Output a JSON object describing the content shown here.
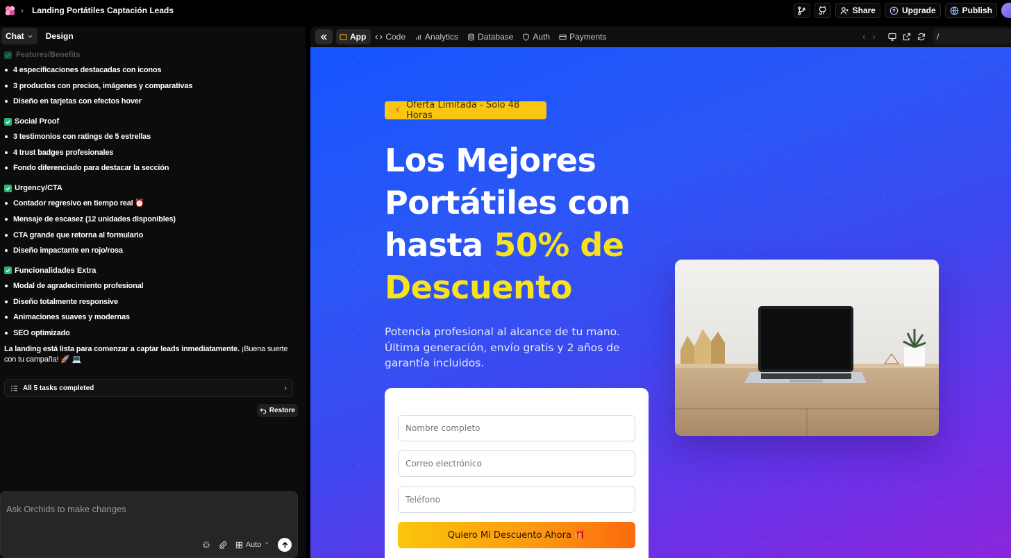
{
  "topbar": {
    "title": "Landing Portátiles Captación Leads",
    "share_label": "Share",
    "upgrade_label": "Upgrade",
    "publish_label": "Publish"
  },
  "left_tabs": {
    "chat": "Chat",
    "design": "Design"
  },
  "chat": {
    "faded_heading": "Features/Benefits",
    "group1": [
      "4 especificaciones destacadas con iconos",
      "3 productos con precios, imágenes y comparativas",
      "Diseño en tarjetas con efectos hover"
    ],
    "sections": [
      {
        "title": "Social Proof",
        "items": [
          "3 testimonios con ratings de 5 estrellas",
          "4 trust badges profesionales",
          "Fondo diferenciado para destacar la sección"
        ]
      },
      {
        "title": "Urgency/CTA",
        "items": [
          "Contador regresivo en tiempo real ⏰",
          "Mensaje de escasez (12 unidades disponibles)",
          "CTA grande que retorna al formulario",
          "Diseño impactante en rojo/rosa"
        ]
      },
      {
        "title": "Funcionalidades Extra",
        "items": [
          "Modal de agradecimiento profesional",
          "Diseño totalmente responsive",
          "Animaciones suaves y modernas",
          "SEO optimizado"
        ]
      }
    ],
    "final_bold": "La landing está lista para comenzar a captar leads inmediatamente.",
    "final_rest": " ¡Buena suerte con tu campaña! 🚀 💻",
    "tasks_label": "All 5 tasks completed",
    "restore_label": "Restore"
  },
  "composer": {
    "placeholder": "Ask Orchids to make changes",
    "mode": "Auto"
  },
  "preview_tabs": [
    "App",
    "Code",
    "Analytics",
    "Database",
    "Auth",
    "Payments"
  ],
  "url": "/",
  "landing": {
    "badge": "Oferta Limitada - Solo 48 Horas",
    "headline_1": "Los Mejores Portátiles con hasta ",
    "headline_highlight": "50% de Descuento",
    "subtitle": "Potencia profesional al alcance de tu mano. Última generación, envío gratis y 2 años de garantía incluidos.",
    "form": {
      "name_placeholder": "Nombre completo",
      "email_placeholder": "Correo electrónico",
      "phone_placeholder": "Teléfono",
      "cta_label": "Quiero Mi Descuento Ahora 🎁"
    }
  },
  "colors": {
    "highlight": "#f8e21b",
    "badge_bg": "#f9c612",
    "check": "#22b573"
  }
}
